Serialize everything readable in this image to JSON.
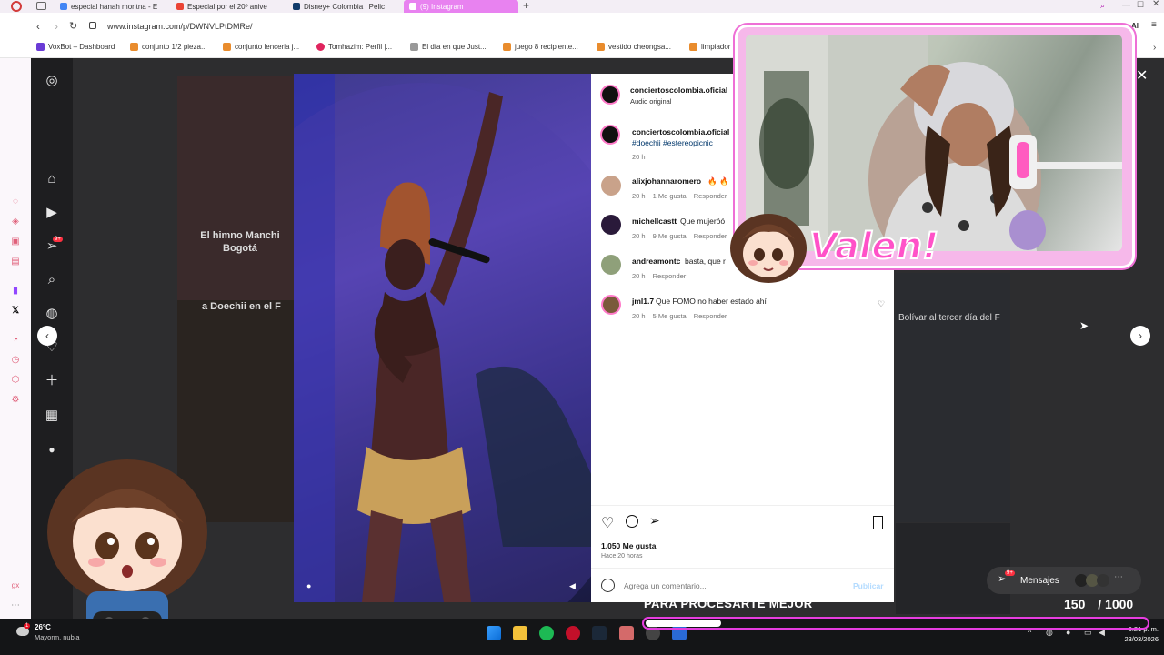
{
  "browser": {
    "tabs": [
      {
        "label": "especial hanah montna - E"
      },
      {
        "label": "Especial por el 20º anive"
      },
      {
        "label": "Disney+ Colombia | Pelic"
      },
      {
        "label": "(9) Instagram"
      }
    ],
    "new_tab": "+",
    "url": "www.instagram.com/p/DWNVLPtDMRe/",
    "bookmarks": [
      {
        "label": "VoxBot – Dashboard"
      },
      {
        "label": "conjunto 1/2 pieza..."
      },
      {
        "label": "conjunto lenceria j..."
      },
      {
        "label": "Tomhazim: Perfil |..."
      },
      {
        "label": "El día en que Just..."
      },
      {
        "label": "juego 8 recipiente..."
      },
      {
        "label": "vestido cheongsa..."
      },
      {
        "label": "limpiador"
      }
    ],
    "ai_label": "AI"
  },
  "instagram": {
    "nav_badge": "9+",
    "grid_texts": {
      "left_top": "El himno Manchi",
      "left_top_2": "Bogotá",
      "left_mid": "a Doechii en el F",
      "right_mid": "Bolívar al tercer día del F"
    },
    "post": {
      "header_user": "conciertoscolombia.oficial",
      "header_audio": "Audio original",
      "caption_user": "conciertoscolombia.oficial",
      "caption_tags": "#doechii #estereopicnic",
      "caption_time": "20 h",
      "comments": [
        {
          "user": "alixjohannaromero",
          "text": "🔥 🔥",
          "time": "20 h",
          "likes": "1 Me gusta",
          "reply": "Responder"
        },
        {
          "user": "michellcastt",
          "text": "Que mujeróó",
          "time": "20 h",
          "likes": "9 Me gusta",
          "reply": "Responder"
        },
        {
          "user": "andreamontc",
          "text": "basta, que r",
          "time": "20 h",
          "likes": "",
          "reply": "Responder"
        },
        {
          "user": "jml1.7",
          "text": "Que FOMO no haber estado ahí",
          "time": "20 h",
          "likes": "5 Me gusta",
          "reply": "Responder"
        }
      ],
      "likes_count": "1.050 Me gusta",
      "posted_ago": "Hace 20 horas",
      "comment_placeholder": "Agrega un comentario...",
      "publish_label": "Publicar"
    },
    "messages_label": "Mensajes",
    "messages_badge": "9+"
  },
  "stream": {
    "streamer_name": "Valen!",
    "overlay_caption": "PARA PROCESARTE MEJOR",
    "goal_current": "150",
    "goal_separator": "/",
    "goal_total": "1000",
    "goal_progress": 0.15
  },
  "taskbar": {
    "weather_temp": "26°C",
    "weather_text": "Mayorm. nubla",
    "weather_badge": "1",
    "time": "6:21 p. m.",
    "date": "23/03/2026"
  },
  "colors": {
    "accent_pink": "#e63de0",
    "active_tab": "#e882f0",
    "ig_link": "#00376b"
  }
}
